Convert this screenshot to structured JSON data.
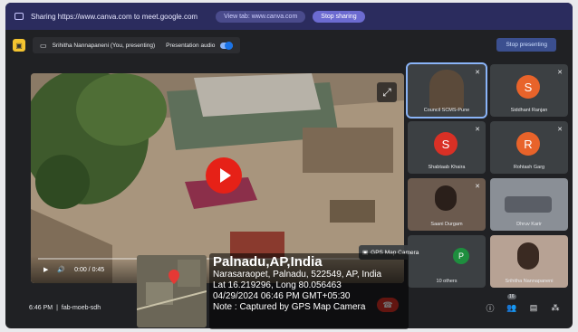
{
  "share_bar": {
    "text": "Sharing https://www.canva.com to meet.google.com",
    "view_tab": "View tab: www.canva.com",
    "stop_sharing": "Stop sharing"
  },
  "presenting": {
    "presenter": "Srihitha Nannapaneni (You, presenting)",
    "audio_label": "Presentation audio",
    "stop_presenting": "Stop presenting"
  },
  "video": {
    "time": "0:00 / 0:45"
  },
  "participants": [
    {
      "name": "Council SCMS-Pune",
      "initial": "",
      "color": "#5b4a3a"
    },
    {
      "name": "Siddhant Ranjan",
      "initial": "S",
      "color": "#e8632a"
    },
    {
      "name": "Shabtaab Khaira",
      "initial": "S",
      "color": "#d93025"
    },
    {
      "name": "Rohtash Garg",
      "initial": "R",
      "color": "#e8632a"
    },
    {
      "name": "Saani Durgam",
      "initial": "",
      "color": "#6b5a4e"
    },
    {
      "name": "Dhruv Karir",
      "initial": "",
      "color": "#8a8f96"
    },
    {
      "name": "10 others",
      "initial": "P",
      "color": "#1e8e3e"
    },
    {
      "name": "Srihitha Nannapaneni",
      "initial": "",
      "color": "#b7a294"
    }
  ],
  "meeting": {
    "time": "6:46 PM",
    "code": "fab-moeb-sdh",
    "people_count": "16"
  },
  "gps": {
    "tag": "GPS Map Camera",
    "city": "Palnadu,AP,India",
    "address": "Narasaraopet, Palnadu, 522549, AP, India",
    "coords": "Lat 16.219296, Long 80.056463",
    "datetime": "04/29/2024 06:46 PM GMT+05:30",
    "note": "Note : Captured by GPS Map Camera"
  }
}
